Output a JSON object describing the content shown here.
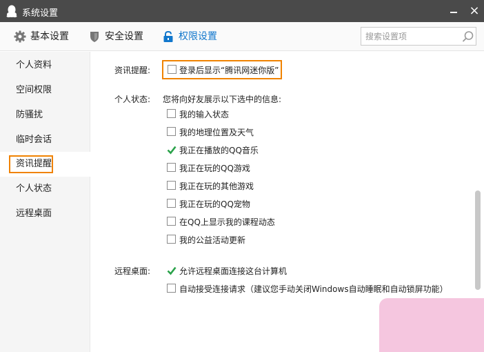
{
  "window": {
    "title": "系统设置",
    "minimize_icon": "minimize-icon",
    "close_icon": "close-icon"
  },
  "tabs": [
    {
      "label": "基本设置",
      "icon": "gear-icon",
      "active": false
    },
    {
      "label": "安全设置",
      "icon": "shield-icon",
      "active": false
    },
    {
      "label": "权限设置",
      "icon": "lock-icon",
      "active": true
    }
  ],
  "search": {
    "placeholder": "搜索设置项",
    "icon": "search-icon"
  },
  "sidebar": {
    "items": [
      {
        "label": "个人资料",
        "active": false
      },
      {
        "label": "空间权限",
        "active": false
      },
      {
        "label": "防骚扰",
        "active": false
      },
      {
        "label": "临时会话",
        "active": false
      },
      {
        "label": "资讯提醒",
        "active": true
      },
      {
        "label": "个人状态",
        "active": false
      },
      {
        "label": "远程桌面",
        "active": false
      }
    ]
  },
  "sections": {
    "news": {
      "label": "资讯提醒:",
      "option": {
        "text": "登录后显示“腾讯网迷你版”",
        "checked": false
      }
    },
    "status": {
      "label": "个人状态:",
      "description": "您将向好友展示以下选中的信息:",
      "options": [
        {
          "text": "我的输入状态",
          "checked": false
        },
        {
          "text": "我的地理位置及天气",
          "checked": false
        },
        {
          "text": "我正在播放的QQ音乐",
          "checked": true
        },
        {
          "text": "我正在玩的QQ游戏",
          "checked": false
        },
        {
          "text": "我正在玩的其他游戏",
          "checked": false
        },
        {
          "text": "我正在玩的QQ宠物",
          "checked": false
        },
        {
          "text": "在QQ上显示我的课程动态",
          "checked": false
        },
        {
          "text": "我的公益活动更新",
          "checked": false
        }
      ]
    },
    "remote": {
      "label": "远程桌面:",
      "options": [
        {
          "text": "允许远程桌面连接这台计算机",
          "checked": true
        },
        {
          "text": "自动接受连接请求（建议您手动关闭Windows自动睡眠和自动锁屏功能）",
          "checked": false
        }
      ]
    }
  },
  "colors": {
    "titlebar": "#4a4a4a",
    "accent": "#1177cc",
    "highlight": "#f08200",
    "check": "#2aa24a"
  }
}
